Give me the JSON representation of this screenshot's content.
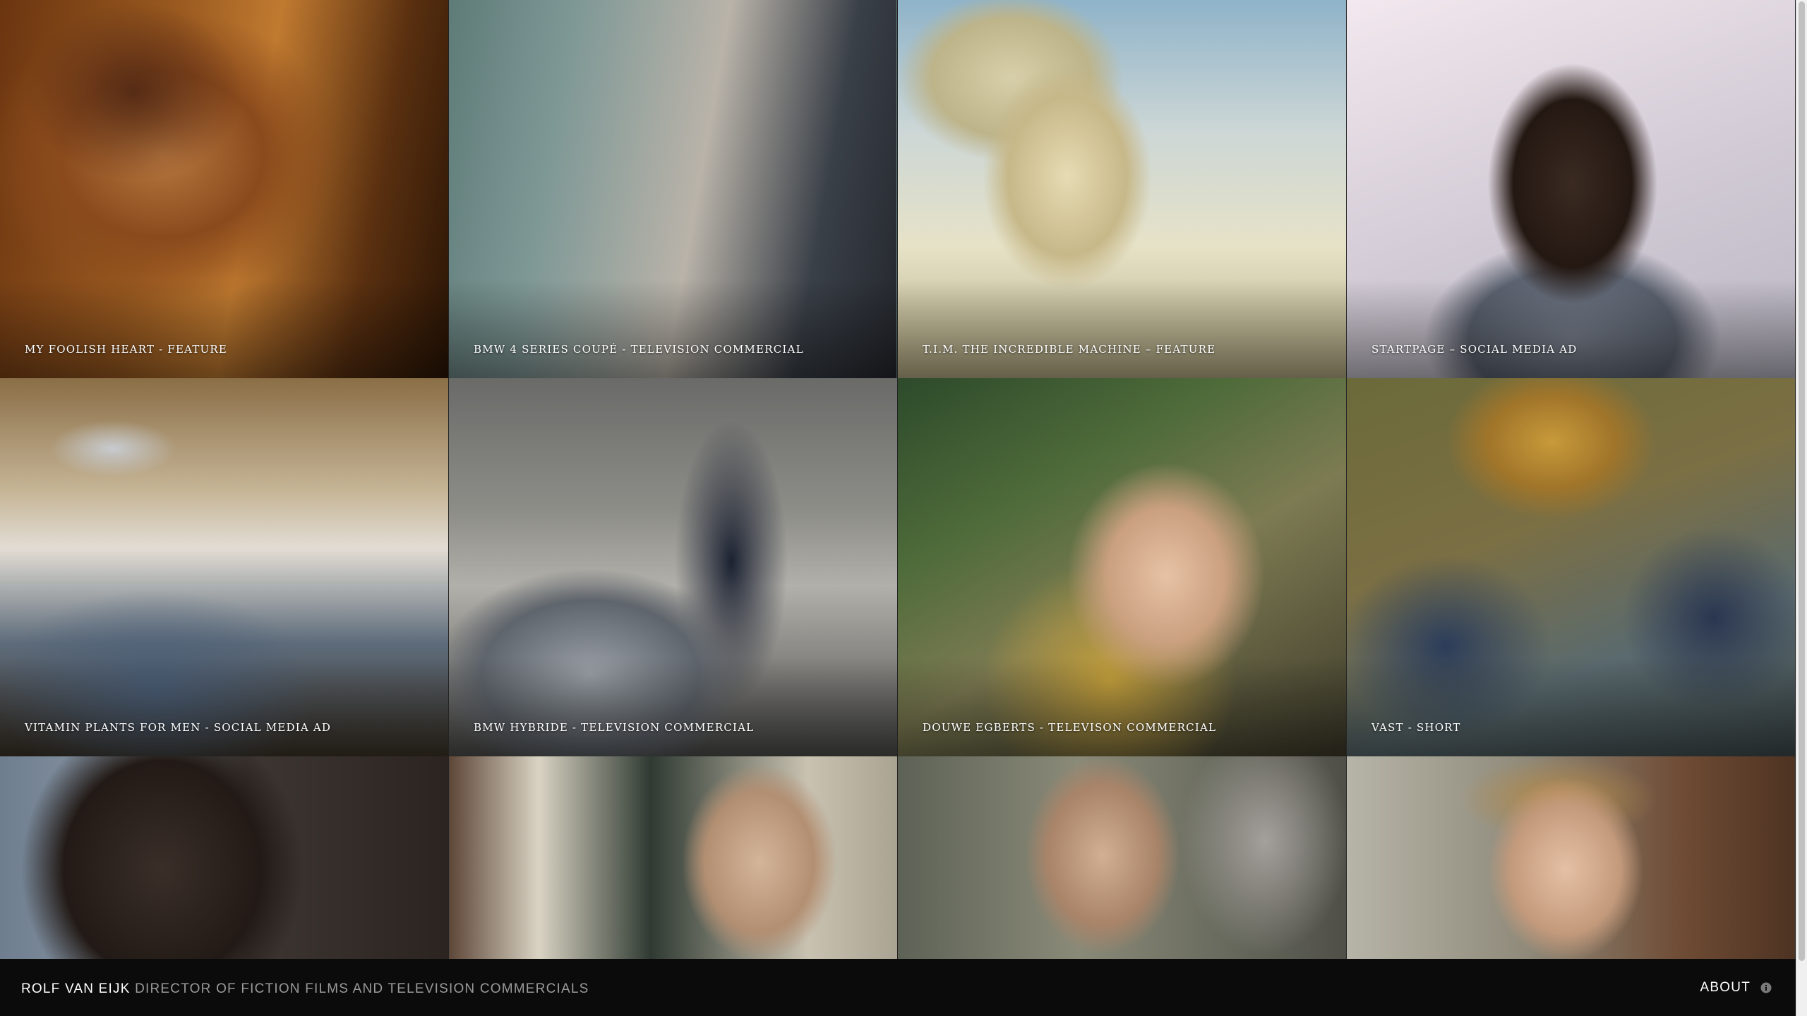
{
  "tiles": [
    {
      "caption": "MY FOOLISH HEART - FEATURE"
    },
    {
      "caption": "BMW 4 SERIES COUPÉ - TELEVISION COMMERCIAL"
    },
    {
      "caption": "T.I.M. THE INCREDIBLE MACHINE – FEATURE"
    },
    {
      "caption": "STARTPAGE – SOCIAL MEDIA AD"
    },
    {
      "caption": "VITAMIN PLANTS FOR MEN - SOCIAL MEDIA AD"
    },
    {
      "caption": "BMW HYBRIDE - TELEVISION COMMERCIAL"
    },
    {
      "caption": "DOUWE EGBERTS - TELEVISON COMMERCIAL"
    },
    {
      "caption": "VAST - SHORT"
    },
    {
      "caption": ""
    },
    {
      "caption": ""
    },
    {
      "caption": ""
    },
    {
      "caption": ""
    }
  ],
  "footer": {
    "name": "ROLF VAN EIJK",
    "tagline": "DIRECTOR OF FICTION FILMS AND TELEVISION COMMERCIALS",
    "about_label": "ABOUT",
    "about_icon": "info-icon"
  },
  "colors": {
    "footer_bg": "#0b0b0b",
    "name": "#ffffff",
    "tagline": "#9a9a9a"
  }
}
